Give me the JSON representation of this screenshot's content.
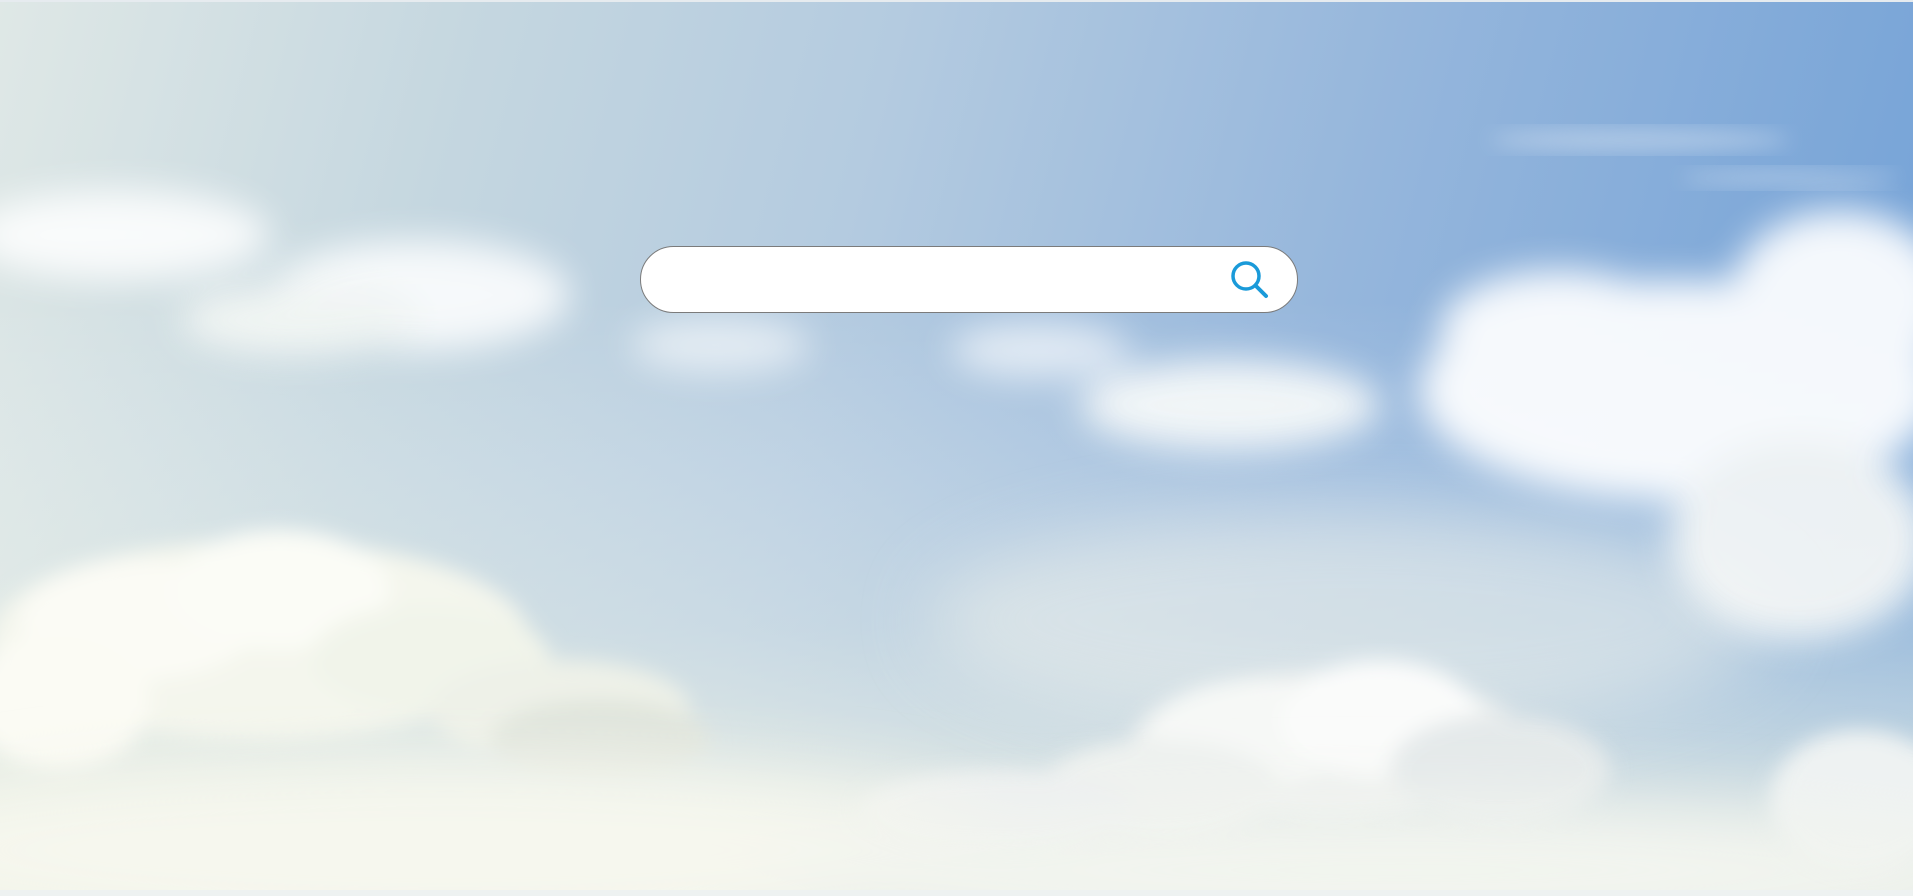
{
  "background": {
    "theme": "sky-with-clouds",
    "colors": {
      "sky_light": "#dfe8e6",
      "sky_mid": "#b4cbe0",
      "sky_deep": "#6f9fd6",
      "cloud": "#ffffff"
    }
  },
  "search": {
    "value": "",
    "placeholder": "",
    "icon": "search-icon",
    "accent_color": "#1a9ad9"
  }
}
